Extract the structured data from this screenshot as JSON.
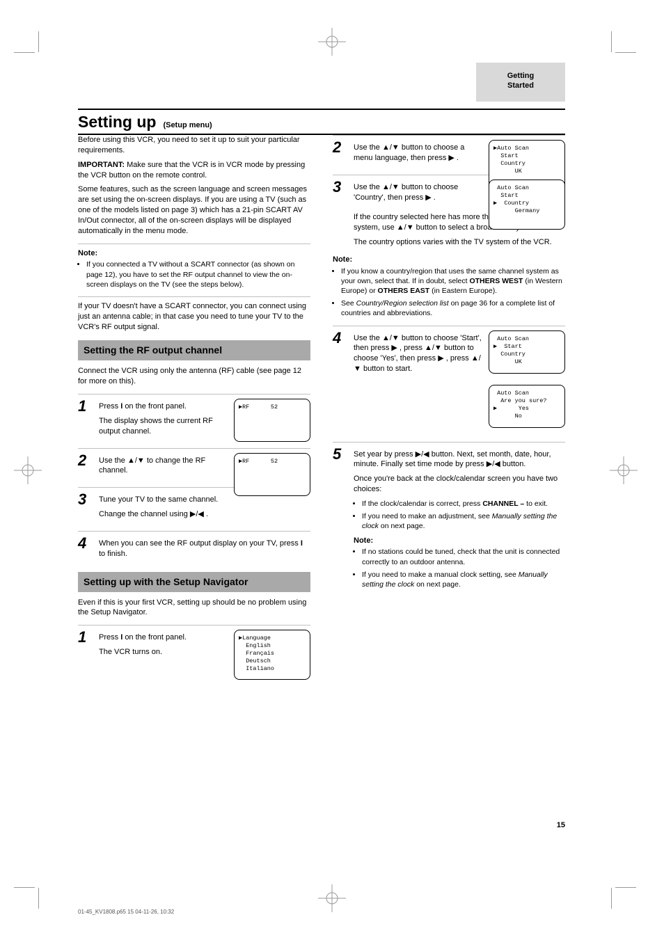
{
  "tab": {
    "line1": "Getting",
    "line2": "Started"
  },
  "title": {
    "main": "Setting up",
    "sub": "(Setup menu)"
  },
  "intro": {
    "p1": "Before using this VCR, you need to set it up to suit your particular requirements.",
    "p2_bold": "IMPORTANT:",
    "p2_rest": " Make sure that the VCR is in VCR mode by pressing the VCR button on the remote control.",
    "p3": "Some features, such as the screen language and screen messages are set using the on-screen displays. If you are using a TV (such as one of the models listed on page 3) which has a 21-pin SCART AV In/Out connector, all of the on-screen displays will be displayed automatically in the menu mode."
  },
  "notes_top": {
    "head": "Note:",
    "items": [
      "If you connected a TV without a SCART connector (as shown on page 12), you have to set the RF output channel to view the on-screen displays on the TV (see the steps below)."
    ]
  },
  "p_no_scart": "If your TV doesn't have a SCART connector, you can connect using just an antenna cable; in that case you need to tune your TV to the VCR's RF output signal.",
  "sectionA": {
    "header": "Setting the RF output channel",
    "intro": "Connect the VCR using only the antenna (RF) cable (see page 12 for more on this).",
    "steps": {
      "s1": {
        "text_a": "Press",
        "bold1": " I ",
        "text_b": "on the front panel.",
        "text_c": "The display shows the current RF output channel.",
        "screen": {
          "l1": "RF      52"
        }
      },
      "s2": {
        "t1": "Use the ",
        "tri": "▲/▼",
        "t2": " to change the RF channel.",
        "screen": {
          "l1": "RF      52"
        }
      },
      "s3": {
        "t1": "Tune your TV to the same channel.",
        "t2_a": "Change the channel using ",
        "tri": "▶/◀",
        "t2_b": "."
      },
      "s4": {
        "t1": "When you can see the RF output display on your TV, press ",
        "bold1": " I ",
        "t2": " to finish."
      }
    }
  },
  "sectionB": {
    "header": "Setting up with the Setup Navigator",
    "intro": "Even if this is your first VCR, setting up should be no problem using the Setup Navigator.",
    "steps": {
      "s1": {
        "t1": "Press ",
        "bold1": " I ",
        "t2": " on the front panel.",
        "t3": "The VCR turns on.",
        "screen": {
          "l1": "Language",
          "l2": "  English",
          "l3": "  Français",
          "l4": "  Deutsch",
          "l5": "  Italiano"
        }
      },
      "b2": {
        "t1": "Use the ",
        "tri": "▲/▼",
        "t2": " button to choose a menu language, then press ",
        "tri2": "▶",
        "t3": ".",
        "screen": {
          "l1": "Auto Scan",
          "l2": "  Start",
          "l3": "  Country",
          "l4": "      UK"
        }
      },
      "b3": {
        "t1": "Use the ",
        "tri": "▲/▼",
        "t2": " button to choose 'Country', then press ",
        "tri2": "▶",
        "t3": ".",
        "screen": {
          "l1": "Auto Scan",
          "l2": "  Start",
          "l3": "  Country",
          "l4": "      Germany"
        }
      },
      "b3b": {
        "t1": "If the country selected here has more than one broadcast system, use ",
        "tri": "▲/▼",
        "t2": " button to select a broadcast system.",
        "t3": "The country options varies with the TV system of the VCR."
      },
      "notes": {
        "head": "Note:",
        "n1a": "If you know a country/region that uses the same channel system as your own, select that. If in doubt, select ",
        "bold1": "OTHERS WEST",
        "n1b": " (in Western Europe) or",
        "bold2": " OTHERS EAST",
        "n1c": " (in Eastern Europe).",
        "n2a": "See ",
        "italic2": "Country/Region selection list",
        "n2b": " on page 36 for a complete list of countries and abbreviations."
      },
      "b4": {
        "t1": "Use the ",
        "tri": "▲/▼",
        "t2": " button to choose 'Start', then press ",
        "tri2": "▶",
        "t3": ", press ",
        "tri3": "▲/▼",
        "t4": " button to choose 'Yes', then press ",
        "tri4": "▶",
        "t5": ", press ",
        "tri5": "▲/▼",
        "t6": " button to start.",
        "screenA": {
          "l1": "Auto Scan",
          "l2": "  Start",
          "l3": "  Country",
          "l4": "      UK"
        },
        "screenB": {
          "l1": "Auto Scan",
          "l2": "  Are you sure?",
          "l3": "      Yes",
          "l4": "      No"
        }
      },
      "b5": {
        "t1a": "Set year by press ",
        "tri1": "▶/◀",
        "t1b": " button. Next, set month, date, hour, minute. Finally set time mode by press ",
        "tri2": "▶/◀",
        "t1c": " button.",
        "p2": "Once you're back at the clock/calendar screen you have two choices:",
        "opt1_a": "If the clock/calendar is correct, press ",
        "opt1_bold": "CHANNEL –",
        "opt1_b": " to exit.",
        "opt2_a": "If you need to make an adjustment, see ",
        "opt2_i": "Manually setting the clock",
        "opt2_b": " on next page.",
        "note_head": "Note:",
        "note_items": [
          "If no stations could be tuned, check that the unit is connected correctly to an outdoor antenna.",
          {
            "pre": "If you need to make a manual clock setting, see ",
            "i": "Manually setting the clock",
            "post": " on next page."
          }
        ]
      }
    }
  },
  "page_number": "15",
  "footer": "01-45_KV1808.p65            15                               04-11-26, 10:32"
}
